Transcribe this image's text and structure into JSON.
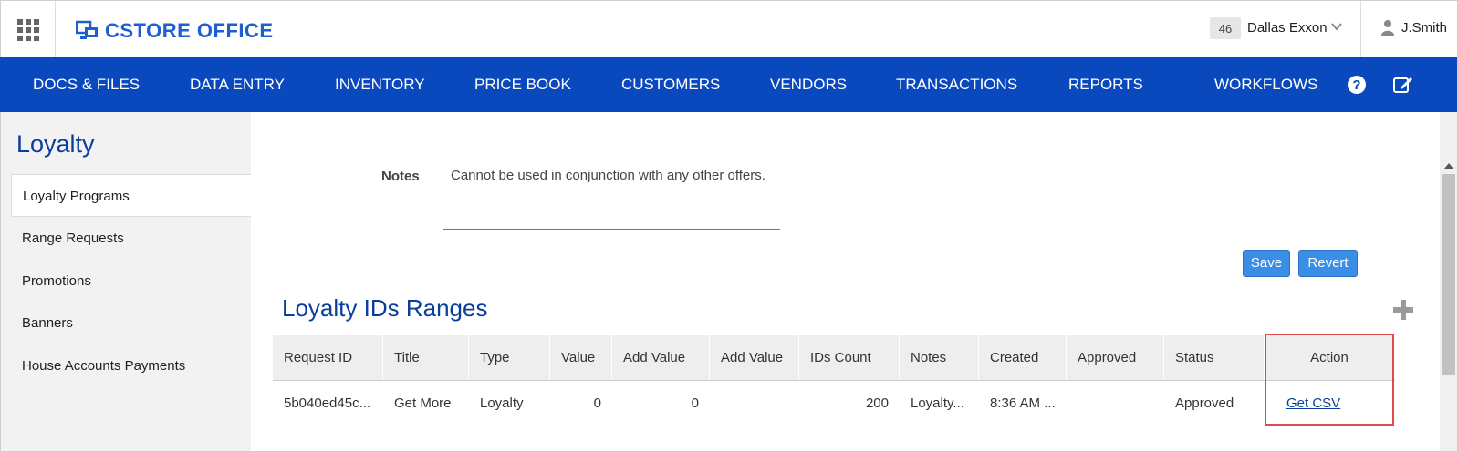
{
  "header": {
    "logo_text": "CSTORE OFFICE",
    "store_number": "46",
    "store_name": "Dallas Exxon",
    "user_name": "J.Smith"
  },
  "nav": {
    "items": [
      "DOCS & FILES",
      "DATA ENTRY",
      "INVENTORY",
      "PRICE BOOK",
      "CUSTOMERS",
      "VENDORS",
      "TRANSACTIONS",
      "REPORTS",
      "WORKFLOWS"
    ]
  },
  "sidebar": {
    "title": "Loyalty",
    "items": [
      "Loyalty Programs",
      "Range Requests",
      "Promotions",
      "Banners",
      "House Accounts Payments"
    ]
  },
  "form": {
    "notes_label": "Notes",
    "notes_value": "Cannot be used in conjunction with any other offers.",
    "save_label": "Save",
    "revert_label": "Revert"
  },
  "section": {
    "title": "Loyalty IDs Ranges"
  },
  "table": {
    "headers": [
      "Request ID",
      "Title",
      "Type",
      "Value",
      "Add Value",
      "Add Value",
      "IDs Count",
      "Notes",
      "Created",
      "Approved",
      "Status",
      "Action"
    ],
    "rows": [
      {
        "request_id": "5b040ed45c...",
        "title": "Get More",
        "type": "Loyalty",
        "value": "0",
        "add_value": "0",
        "add_value2": "",
        "ids_count": "200",
        "notes": "Loyalty...",
        "created": "8:36 AM ...",
        "approved": "",
        "status": "Approved",
        "action": "Get CSV"
      }
    ]
  },
  "colors": {
    "nav_bg": "#0a48bd",
    "title_blue": "#0a3e9e",
    "button_blue": "#3a8ee6",
    "highlight_red": "#e04a4a"
  },
  "icons": [
    "apps-grid-icon",
    "logo-monitor-icon",
    "chevron-down-icon",
    "user-icon",
    "help-icon",
    "edit-icon",
    "plus-icon"
  ]
}
